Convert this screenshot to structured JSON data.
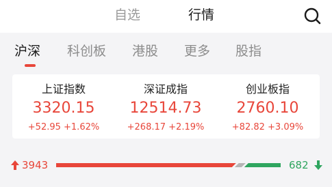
{
  "top_nav": {
    "tabs": [
      "自选",
      "行情"
    ],
    "active_index": 1,
    "search_icon": "search-icon"
  },
  "market_tabs": {
    "items": [
      "沪深",
      "科创板",
      "港股",
      "更多",
      "股指"
    ],
    "active_index": 0
  },
  "indices": [
    {
      "name": "上证指数",
      "value": "3320.15",
      "change": "+52.95 +1.62%"
    },
    {
      "name": "深证成指",
      "value": "12514.73",
      "change": "+268.17 +2.19%"
    },
    {
      "name": "创业板指",
      "value": "2760.10",
      "change": "+82.82 +3.09%"
    }
  ],
  "breadth": {
    "up_count": "3943",
    "down_count": "682",
    "up": 3943,
    "flat": 0,
    "down": 682
  },
  "colors": {
    "up": "#e8463a",
    "down": "#2fa55f",
    "flat": "#b5b5b5",
    "active_text": "#1a1a1a",
    "inactive_text": "#8c8c8c"
  }
}
